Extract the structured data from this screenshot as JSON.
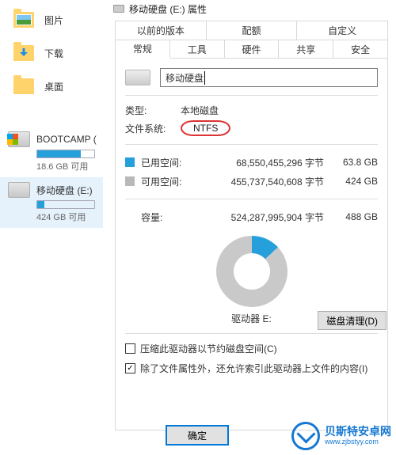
{
  "sidebar": {
    "items": [
      {
        "label": "图片"
      },
      {
        "label": "下载"
      },
      {
        "label": "桌面"
      }
    ]
  },
  "drives": [
    {
      "label": "BOOTCAMP (",
      "sub": "18.6 GB 可用",
      "fill_pct": 76,
      "selected": false,
      "win": true
    },
    {
      "label": "移动硬盘 (E:)",
      "sub": "424 GB 可用",
      "fill_pct": 13,
      "selected": true,
      "win": false
    }
  ],
  "dialog": {
    "title": "移动硬盘 (E:) 属性",
    "tabs_top": [
      "以前的版本",
      "配额",
      "自定义"
    ],
    "tabs_bottom": [
      "常规",
      "工具",
      "硬件",
      "共享",
      "安全"
    ],
    "name_value": "移动硬盘",
    "type_label": "类型:",
    "type_value": "本地磁盘",
    "fs_label": "文件系统:",
    "fs_value": "NTFS",
    "used_label": "已用空间:",
    "used_bytes": "68,550,455,296 字节",
    "used_gb": "63.8 GB",
    "free_label": "可用空间:",
    "free_bytes": "455,737,540,608 字节",
    "free_gb": "424 GB",
    "cap_label": "容量:",
    "cap_bytes": "524,287,995,904 字节",
    "cap_gb": "488 GB",
    "drive_letter": "驱动器 E:",
    "cleanup": "磁盘清理(D)",
    "cb1": "压缩此驱动器以节约磁盘空间(C)",
    "cb2": "除了文件属性外，还允许索引此驱动器上文件的内容(I)",
    "ok": "确定"
  },
  "watermark": {
    "brand": "贝斯特安卓网",
    "url": "www.zjbstyy.com"
  }
}
